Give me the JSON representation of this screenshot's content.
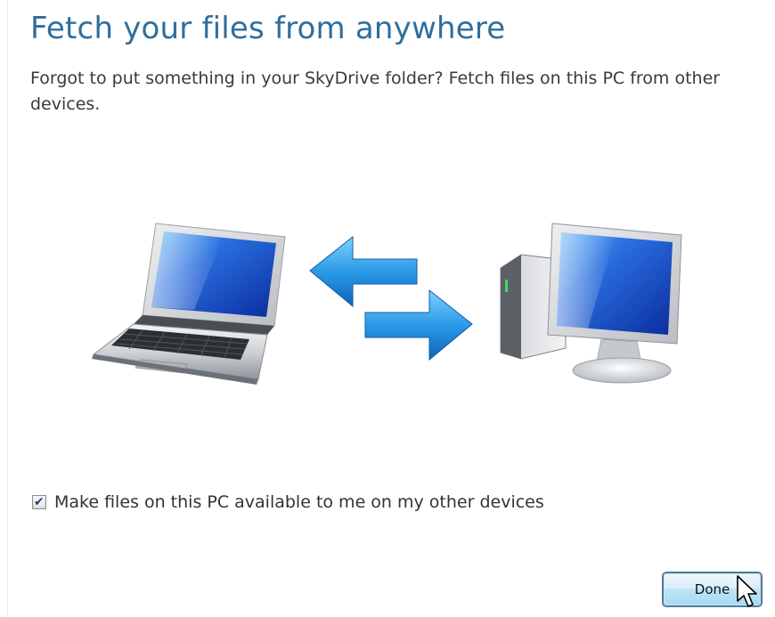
{
  "page": {
    "title": "Fetch your files from anywhere",
    "description": "Forgot to put something in your SkyDrive folder? Fetch files on this PC from other devices."
  },
  "illustration": {
    "left_device": "laptop-icon",
    "middle": "sync-arrows-icon",
    "right_device": "desktop-pc-icon"
  },
  "checkbox": {
    "label": "Make files on this PC available to me on my other devices",
    "checked": true
  },
  "buttons": {
    "done_label": "Done"
  },
  "colors": {
    "title": "#2f6e9c",
    "button_top": "#eef7fd",
    "button_bottom": "#a7d9f5",
    "arrow_blue": "#1e88d0"
  }
}
